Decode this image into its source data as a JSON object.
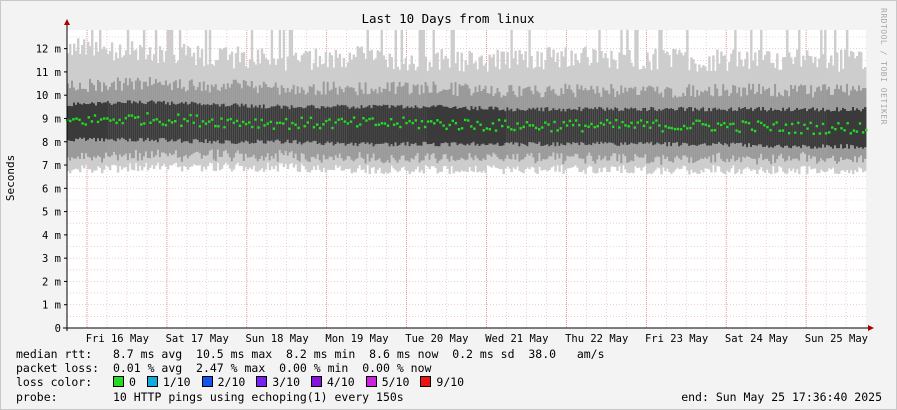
{
  "chart_data": {
    "type": "area",
    "title": "Last 10 Days from linux",
    "ylabel": "Seconds",
    "xlabel": "",
    "ylim": [
      0,
      0.0128
    ],
    "y_ticks": [
      {
        "v": 0,
        "label": "0"
      },
      {
        "v": 0.001,
        "label": "1 m"
      },
      {
        "v": 0.002,
        "label": "2 m"
      },
      {
        "v": 0.003,
        "label": "3 m"
      },
      {
        "v": 0.004,
        "label": "4 m"
      },
      {
        "v": 0.005,
        "label": "5 m"
      },
      {
        "v": 0.006,
        "label": "6 m"
      },
      {
        "v": 0.007,
        "label": "7 m"
      },
      {
        "v": 0.008,
        "label": "8 m"
      },
      {
        "v": 0.009,
        "label": "9 m"
      },
      {
        "v": 0.01,
        "label": "10 m"
      },
      {
        "v": 0.011,
        "label": "11 m"
      },
      {
        "v": 0.012,
        "label": "12 m"
      }
    ],
    "x_ticks": [
      "Fri 16 May",
      "Sat 17 May",
      "Sun 18 May",
      "Mon 19 May",
      "Tue 20 May",
      "Wed 21 May",
      "Thu 22 May",
      "Fri 23 May",
      "Sat 24 May",
      "Sun 25 May"
    ],
    "x_days_span": 10,
    "series": [
      {
        "name": "median rtt",
        "color": "#22dd22",
        "values": [
          0.0089,
          0.009,
          0.0089,
          0.0088,
          0.0088,
          0.0088,
          0.0087,
          0.0087,
          0.0087,
          0.0087,
          0.0086,
          0.0086
        ]
      },
      {
        "name": "smoke inner range (low/high)",
        "color": "#3a3a3a",
        "low": [
          0.0082,
          0.0082,
          0.0081,
          0.0081,
          0.008,
          0.008,
          0.008,
          0.008,
          0.008,
          0.008,
          0.0079,
          0.0079
        ],
        "high": [
          0.0095,
          0.0096,
          0.0095,
          0.0094,
          0.0094,
          0.0094,
          0.0093,
          0.0093,
          0.0093,
          0.0093,
          0.0093,
          0.0093
        ]
      },
      {
        "name": "smoke outer range (low/high)",
        "color": "#c8c8c8",
        "low": [
          0.007,
          0.0071,
          0.0071,
          0.0071,
          0.007,
          0.007,
          0.007,
          0.007,
          0.007,
          0.007,
          0.007,
          0.007
        ],
        "high": [
          0.0115,
          0.0113,
          0.0112,
          0.011,
          0.0112,
          0.011,
          0.011,
          0.0112,
          0.011,
          0.011,
          0.011,
          0.011
        ]
      }
    ],
    "grid": true,
    "legend_position": "bottom"
  },
  "colors": {
    "median": "#22dd22",
    "grid_minor": "#e6b0b0",
    "grid_major": "#e08080",
    "axis": "#000000",
    "arrow": "#aa0000",
    "background": "#f3f3f3",
    "plot_background": "#ffffff"
  },
  "stats": {
    "median_rtt_label": "median rtt:",
    "median_rtt_values": "8.7 ms avg  10.5 ms max  8.2 ms min  8.6 ms now  0.2 ms sd  38.0   am/s",
    "packet_loss_label": "packet loss:",
    "packet_loss_values": "0.01 % avg  2.47 % max  0.00 % min  0.00 % now",
    "loss_color_label": "loss color:",
    "loss_colors": [
      {
        "label": "0",
        "color": "#22dd22"
      },
      {
        "label": "1/10",
        "color": "#11aadd"
      },
      {
        "label": "2/10",
        "color": "#1155ee"
      },
      {
        "label": "3/10",
        "color": "#7722ee"
      },
      {
        "label": "4/10",
        "color": "#8811dd"
      },
      {
        "label": "5/10",
        "color": "#cc22dd"
      },
      {
        "label": "9/10",
        "color": "#ee1111"
      }
    ],
    "probe_label": "probe:",
    "probe_value": "10 HTTP pings using echoping(1) every 150s",
    "end_label": "end: Sun May 25 17:36:40 2025"
  },
  "watermark": "RRDTOOL / TOBI OETIKER"
}
